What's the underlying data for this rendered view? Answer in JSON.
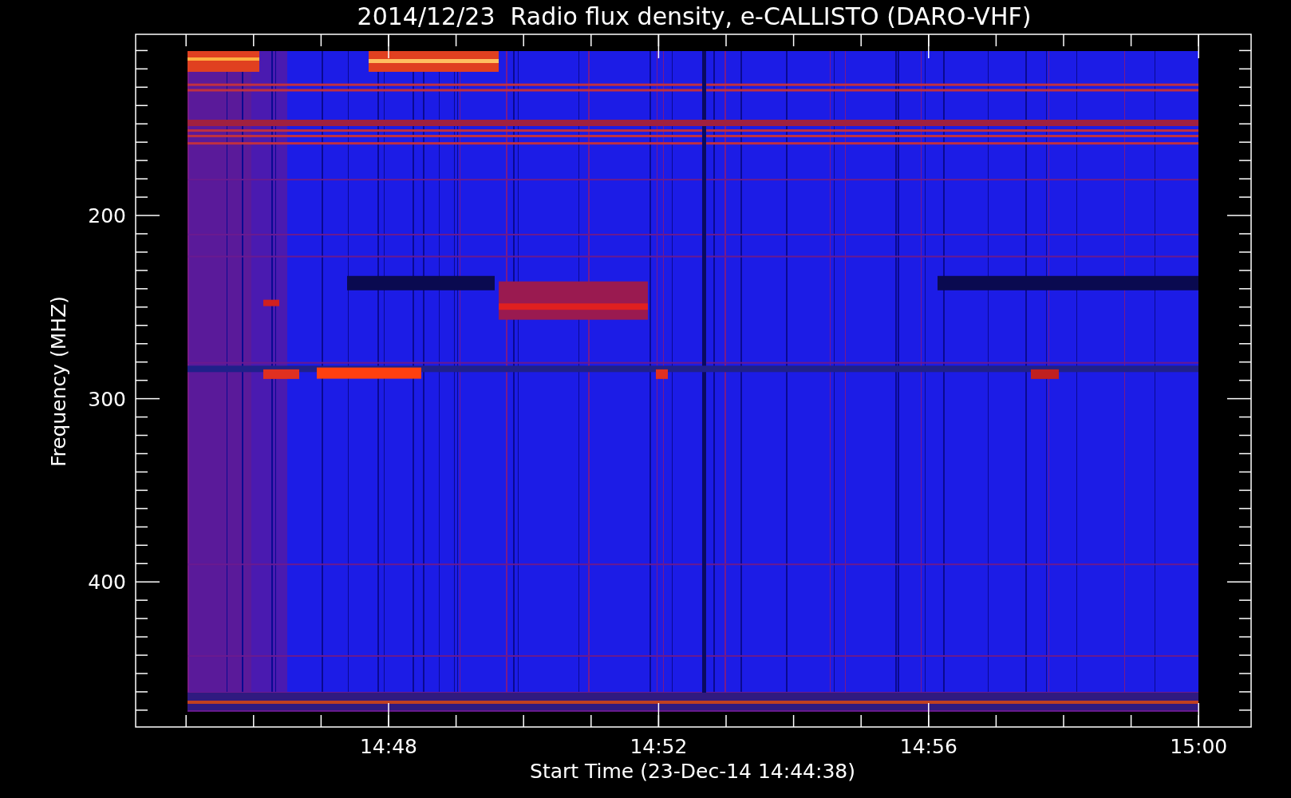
{
  "title": "2014/12/23  Radio flux density, e-CALLISTO (DARO-VHF)",
  "y_axis": {
    "label": "Frequency (MHZ)",
    "ticks": [
      "200",
      "300",
      "400"
    ]
  },
  "x_axis": {
    "label": "Start Time (23-Dec-14 14:44:38)",
    "ticks": [
      "14:48",
      "14:52",
      "14:56",
      "15:00"
    ]
  }
}
